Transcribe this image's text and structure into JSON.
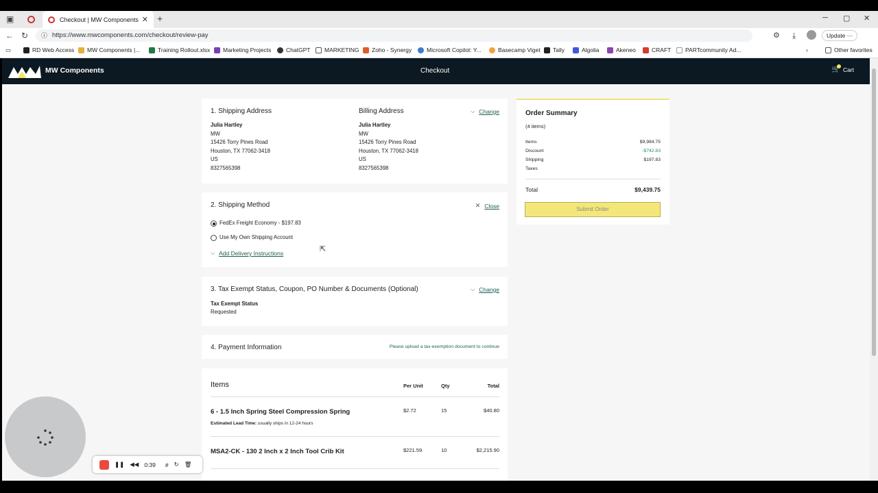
{
  "browser": {
    "tab_title": "Checkout | MW Components",
    "url": "https://www.mwcomponents.com/checkout/review-pay",
    "update_label": "Update",
    "bookmarks": [
      "RD Web Access",
      "MW Components |...",
      "Training Rollout.xlsx",
      "Marketing Projects",
      "ChatGPT",
      "MARKETING",
      "Zoho - Synergy",
      "Microsoft Copilot: Y...",
      "Basecamp Viget",
      "Tally",
      "Algolia",
      "Akeneo",
      "CRAFT",
      "PARTcommunity Ad..."
    ],
    "other_favorites": "Other favorites"
  },
  "header": {
    "brand": "MW Components",
    "title": "Checkout",
    "cart_label": "Cart"
  },
  "shipping_address": {
    "title": "1. Shipping Address",
    "name": "Julia Hartley",
    "company": "MW",
    "street": "15426 Torry Pines Road",
    "city": "Houston, TX 77062-3418",
    "country": "US",
    "phone": "8327565398"
  },
  "billing_address": {
    "title": "Billing Address",
    "change": "Change",
    "name": "Julia Hartley",
    "company": "MW",
    "street": "15426 Torry Pines Road",
    "city": "Houston, TX 77062-3418",
    "country": "US",
    "phone": "8327565398"
  },
  "shipping_method": {
    "title": "2. Shipping Method",
    "close": "Close",
    "option1": "FedEx Freight Economy - $197.83",
    "option2": "Use My Own Shipping Account",
    "delivery_instructions": "Add Delivery Instructions"
  },
  "tax": {
    "title": "3. Tax Exempt Status, Coupon, PO Number & Documents (Optional)",
    "change": "Change",
    "status_label": "Tax Exempt Status",
    "status_value": "Requested"
  },
  "payment": {
    "title": "4. Payment Information",
    "note": "Please upload a tax-exemption document to continue"
  },
  "items": {
    "title": "Items",
    "headers": {
      "per_unit": "Per Unit",
      "qty": "Qty",
      "total": "Total"
    },
    "rows": [
      {
        "name": "6 - 1.5 Inch Spring Steel Compression Spring",
        "per_unit": "$2.72",
        "qty": "15",
        "total": "$40.80",
        "lead_label": "Estimated Lead Time:",
        "lead_value": "usually ships in 12-24 hours"
      },
      {
        "name": "MSA2-CK - 130 2 Inch x 2 Inch Tool Crib Kit",
        "per_unit": "$221.59",
        "qty": "10",
        "total": "$2,215.90"
      }
    ]
  },
  "summary": {
    "title": "Order Summary",
    "count": "(4 items)",
    "items_label": "Items",
    "items_value": "$9,984.75",
    "discount_label": "Discount",
    "discount_value": "-$742.83",
    "shipping_label": "Shipping",
    "shipping_value": "$197.83",
    "taxes_label": "Taxes",
    "total_label": "Total",
    "total_value": "$9,439.75",
    "submit": "Submit Order"
  },
  "recorder": {
    "time": "0:39"
  },
  "colors": {
    "accent": "#1d5f52",
    "header": "#0d1922",
    "submit": "#f3e77a"
  }
}
